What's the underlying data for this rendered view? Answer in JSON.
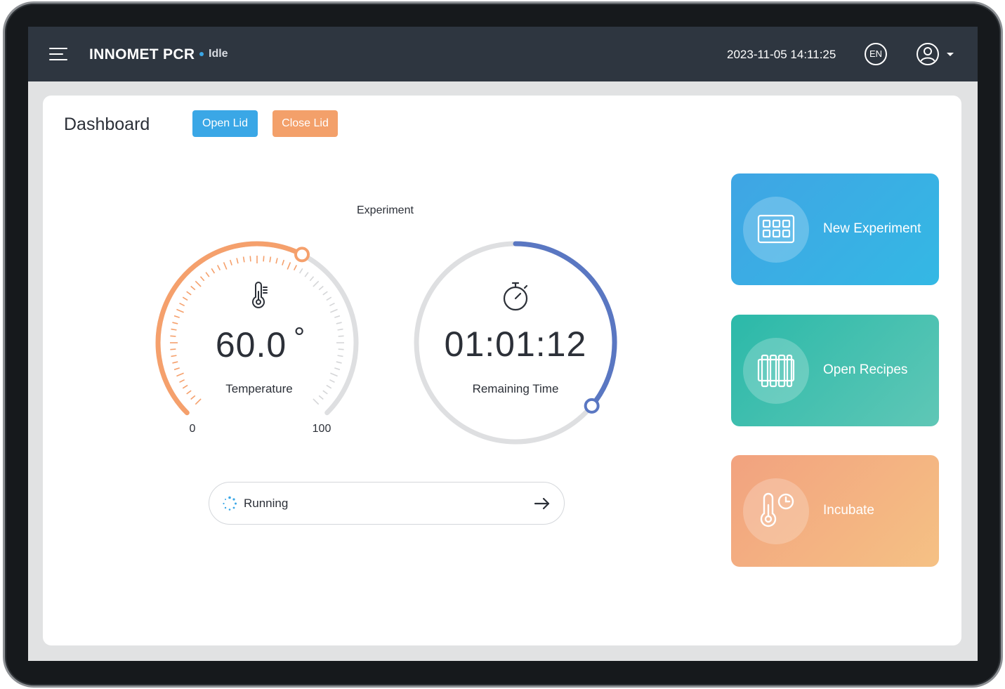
{
  "header": {
    "app_title": "INNOMET PCR",
    "status": "Idle",
    "datetime": "2023-11-05 14:11:25",
    "language": "EN"
  },
  "page": {
    "title": "Dashboard",
    "open_lid_label": "Open Lid",
    "close_lid_label": "Close Lid",
    "section_label": "Experiment"
  },
  "temperature": {
    "value": "60.0",
    "unit": "°",
    "label": "Temperature",
    "min": "0",
    "max": "100",
    "fraction": 0.6
  },
  "timer": {
    "value": "01:01:12",
    "label": "Remaining Time",
    "fraction": 0.36
  },
  "run": {
    "status": "Running"
  },
  "actions": {
    "new_experiment": "New Experiment",
    "open_recipes": "Open Recipes",
    "incubate": "Incubate"
  },
  "colors": {
    "topbar": "#2e3640",
    "accent_blue": "#3aa7e6",
    "accent_orange": "#f3a06a",
    "temperature_arc": "#f5a06c",
    "timer_arc": "#5a77c2"
  },
  "icons": {
    "menu": "hamburger-icon",
    "language": "globe-en-icon",
    "user": "user-circle-icon",
    "temperature": "thermometer-icon",
    "timer": "stopwatch-icon",
    "running": "spinner-icon",
    "go": "arrow-right-icon",
    "new_experiment": "plate-grid-icon",
    "open_recipes": "recipes-rack-icon",
    "incubate": "thermometer-clock-icon"
  }
}
